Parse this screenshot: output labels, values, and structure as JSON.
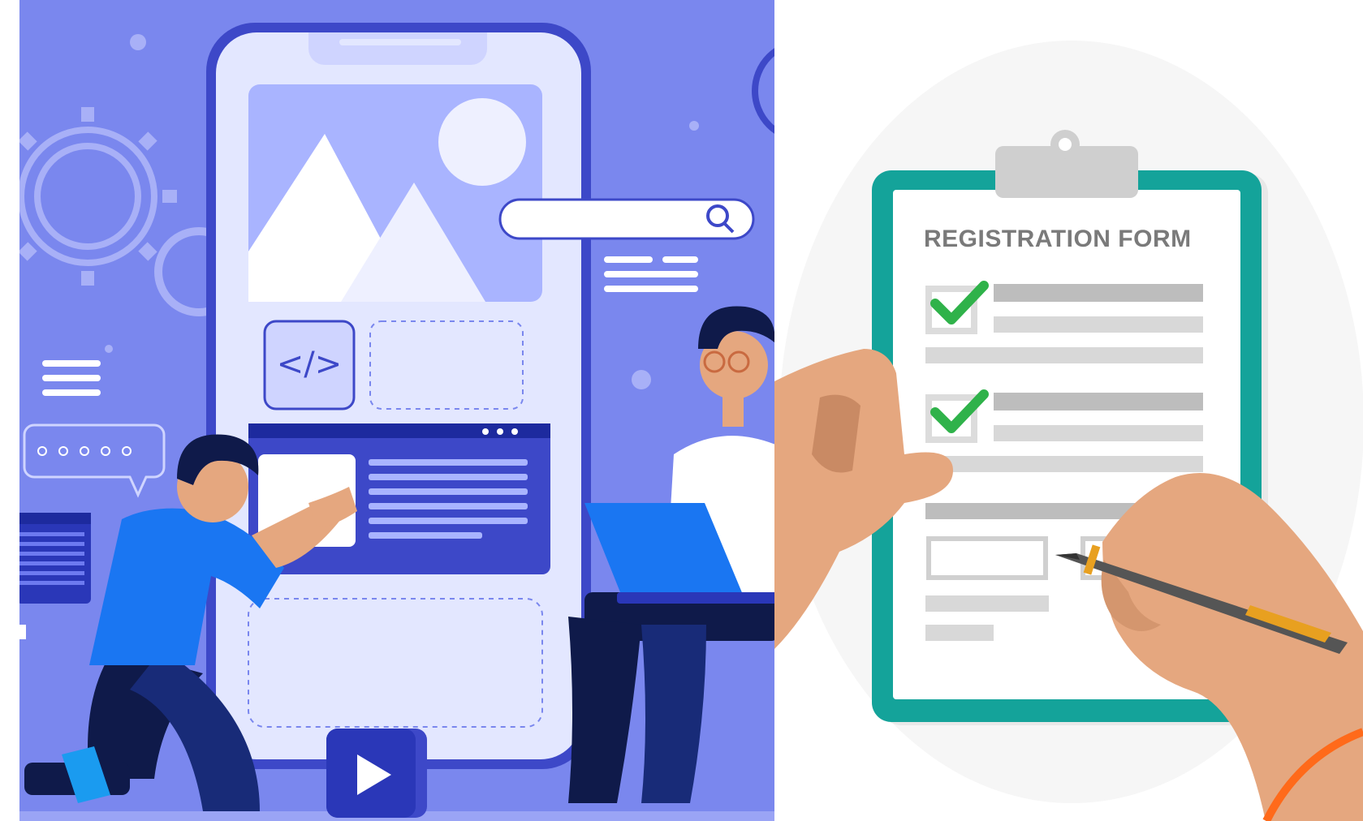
{
  "illustration": {
    "clipboard": {
      "title": "REGISTRATION FORM",
      "checked_items": 2
    },
    "icons": {
      "code": "code-icon",
      "search": "search-icon",
      "play": "play-icon",
      "gear": "gear-icon",
      "chat": "chat-bubble-icon"
    },
    "colors": {
      "left_bg": "#7a87ee",
      "phone_frame": "#3d48c8",
      "phone_screen": "#e3e7ff",
      "clipboard_frame": "#14a39a",
      "check": "#2fb24a",
      "skin": "#e5a77f",
      "pen": "#e8a020",
      "accent_orange": "#ff6a1a"
    }
  }
}
